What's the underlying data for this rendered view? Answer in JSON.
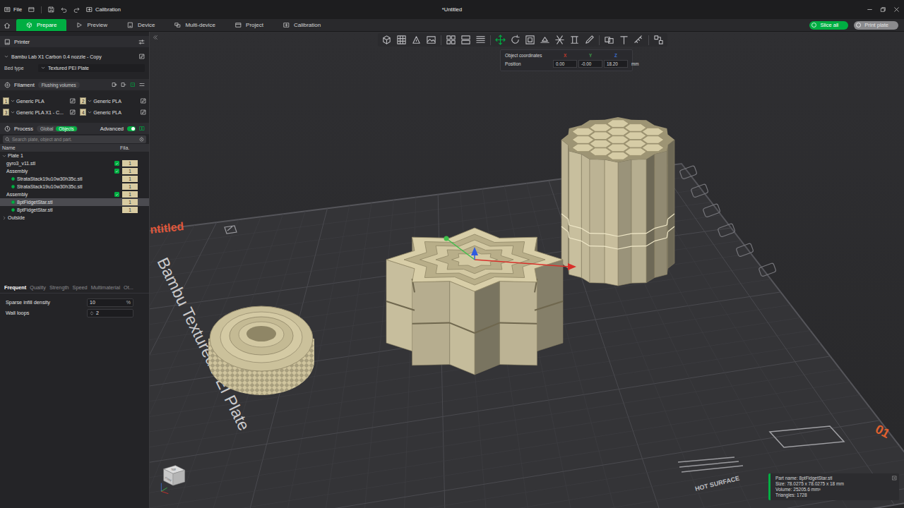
{
  "title_bar": {
    "menu": "File",
    "quick": "Calibration",
    "title": "*Untitled"
  },
  "tabs": [
    {
      "label": "Prepare",
      "selected": true
    },
    {
      "label": "Preview",
      "selected": false
    },
    {
      "label": "Device",
      "selected": false
    },
    {
      "label": "Multi-device",
      "selected": false
    },
    {
      "label": "Project",
      "selected": false
    },
    {
      "label": "Calibration",
      "selected": false
    }
  ],
  "actions": [
    {
      "label": "Slice all",
      "disabled": false
    },
    {
      "label": "Print plate",
      "disabled": true
    }
  ],
  "printer": {
    "title": "Printer",
    "name": "Bambu Lab X1 Carbon 0.4 nozzle - Copy",
    "bed_label": "Bed type",
    "bed_value": "Textured PEI Plate"
  },
  "filament": {
    "title": "Filament",
    "flush": "Flushing volumes",
    "slots": [
      {
        "number": "1",
        "name": "Generic PLA"
      },
      {
        "number": "2",
        "name": "Generic PLA"
      },
      {
        "number": "3",
        "name": "Generic PLA X1 - C..."
      },
      {
        "number": "4",
        "name": "Generic PLA"
      }
    ]
  },
  "process": {
    "title": "Process",
    "modes": [
      {
        "label": "Global",
        "selected": false
      },
      {
        "label": "Objects",
        "selected": true
      }
    ],
    "advanced": {
      "label": "Advanced",
      "on": true
    },
    "search": {
      "placeholder": "Search plate, object and part."
    }
  },
  "tree": {
    "columns": [
      "Name",
      "Fila."
    ],
    "rows": [
      {
        "kind": "plate",
        "name": "Plate 1",
        "depth": 0,
        "expanded": true,
        "selected": false
      },
      {
        "kind": "object",
        "name": "gyro3_v11.stl",
        "depth": 1,
        "checked": true,
        "filament": "1",
        "selected": false
      },
      {
        "kind": "object",
        "name": "Assembly",
        "depth": 1,
        "checked": true,
        "filament": "1",
        "selected": false
      },
      {
        "kind": "part",
        "name": "StrataStack19u10w30h35c.stl",
        "depth": 2,
        "filament": "1",
        "selected": false
      },
      {
        "kind": "part",
        "name": "StrataStack19u10w30h35c.stl",
        "depth": 2,
        "filament": "1",
        "selected": false
      },
      {
        "kind": "object",
        "name": "Assembly",
        "depth": 1,
        "checked": true,
        "filament": "1",
        "selected": false
      },
      {
        "kind": "part",
        "name": "8ptFidgetStar.stl",
        "depth": 2,
        "filament": "1",
        "selected": true
      },
      {
        "kind": "part",
        "name": "8ptFidgetStar.stl",
        "depth": 2,
        "filament": "1",
        "selected": false
      },
      {
        "kind": "plate",
        "name": "Outside",
        "depth": 0,
        "expanded": false,
        "selected": false
      }
    ]
  },
  "settings": {
    "tabs": [
      {
        "label": "Frequent",
        "selected": true
      },
      {
        "label": "Quality",
        "selected": false
      },
      {
        "label": "Strength",
        "selected": false
      },
      {
        "label": "Speed",
        "selected": false
      },
      {
        "label": "Multimaterial",
        "selected": false
      },
      {
        "label": "Ot...",
        "selected": false
      }
    ],
    "rows": [
      {
        "kind": "percent",
        "label": "Sparse infill density",
        "value": "10",
        "unit": "%"
      },
      {
        "kind": "spin",
        "label": "Wall loops",
        "value": "2"
      }
    ]
  },
  "toolbar": [
    {
      "active": false
    },
    {
      "active": false
    },
    {
      "active": false
    },
    {
      "active": false
    },
    {
      "active": false
    },
    {
      "active": false
    },
    {
      "active": false
    },
    {
      "active": true
    },
    {
      "active": false
    },
    {
      "active": false
    },
    {
      "active": false
    },
    {
      "active": false
    },
    {
      "active": false
    },
    {
      "active": false
    },
    {
      "active": false
    },
    {
      "active": false
    },
    {
      "active": false
    },
    {
      "active": false
    }
  ],
  "coords": {
    "title": "Object coordinates",
    "axes": [
      {
        "label": "X",
        "color": "#c0392b"
      },
      {
        "label": "Y",
        "color": "#3d9a4a"
      },
      {
        "label": "Z",
        "color": "#3b6fd1"
      }
    ],
    "row_label": "Position",
    "values": [
      "0.00",
      "-0.00",
      "18.20"
    ],
    "unit": "mm"
  },
  "info": {
    "lines": [
      "Part name: 8ptFidgetStar.stl",
      "Size: 78.0275 x 78.0275 x 18 mm",
      "Volume: 25205.6 mm³",
      "Triangles: 1728"
    ]
  },
  "plate": {
    "name": "ntitled",
    "type": "Bambu Textured PEI Plate",
    "warning": "HOT SURFACE",
    "number": "01"
  },
  "view_cube": {
    "top": "Top",
    "front": "Front"
  }
}
